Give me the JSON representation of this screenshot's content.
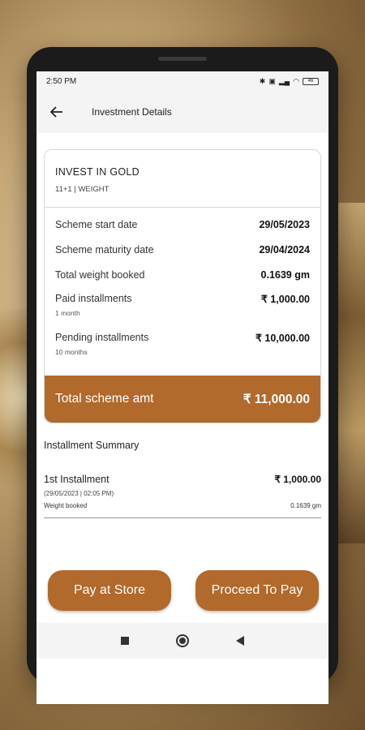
{
  "status": {
    "time": "2:50 PM",
    "icons": [
      "bluetooth-icon",
      "sim-icon",
      "signal-icon",
      "wifi-icon"
    ],
    "battery": "46"
  },
  "appbar": {
    "title": "Investment Details",
    "back_icon": "arrow-left-icon"
  },
  "scheme": {
    "title": "INVEST IN GOLD",
    "subtitle": "11+1 | WEIGHT",
    "rows": [
      {
        "label": "Scheme start date",
        "value": "29/05/2023"
      },
      {
        "label": "Scheme maturity date",
        "value": "29/04/2024"
      },
      {
        "label": "Total weight booked",
        "value": "0.1639 gm"
      }
    ],
    "paid": {
      "label": "Paid installments",
      "note": "1 month",
      "value": "₹ 1,000.00"
    },
    "pending": {
      "label": "Pending installments",
      "note": "10 months",
      "value": "₹ 10,000.00"
    },
    "total": {
      "label": "Total scheme amt",
      "value": "₹ 11,000.00"
    }
  },
  "summary": {
    "title": "Installment Summary",
    "items": [
      {
        "name": "1st Installment",
        "amount": "₹ 1,000.00",
        "date": "(29/05/2023 | 02:05 PM)",
        "weight_label": "Weight booked",
        "weight": "0.1639 gm"
      }
    ]
  },
  "actions": {
    "pay_store": "Pay at Store",
    "proceed": "Proceed To Pay"
  },
  "colors": {
    "accent": "#b2692c"
  }
}
